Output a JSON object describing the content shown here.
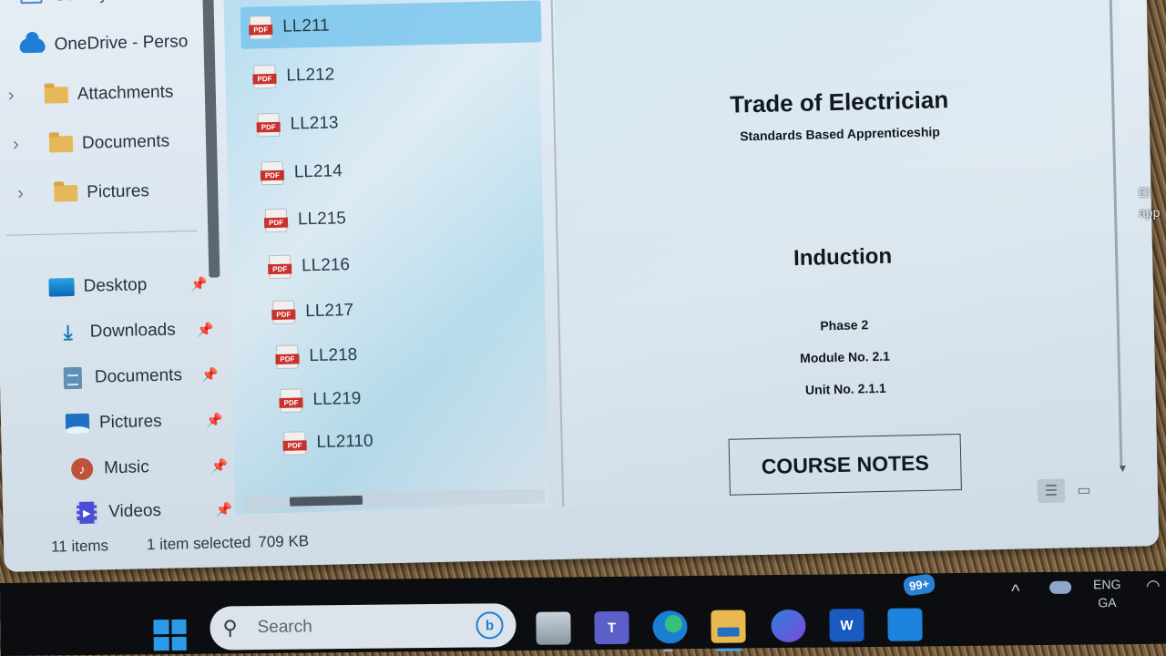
{
  "sidebar": {
    "top_partial": "Gallery",
    "onedrive": {
      "label": "OneDrive - Perso",
      "icon": "cloud-icon"
    },
    "onedrive_children": [
      {
        "label": "Attachments",
        "icon": "folder-icon"
      },
      {
        "label": "Documents",
        "icon": "folder-icon"
      },
      {
        "label": "Pictures",
        "icon": "folder-icon"
      }
    ],
    "quick_access": [
      {
        "label": "Desktop",
        "icon": "desktop-icon",
        "pinned": true
      },
      {
        "label": "Downloads",
        "icon": "download-icon",
        "pinned": true
      },
      {
        "label": "Documents",
        "icon": "documents-icon",
        "pinned": true
      },
      {
        "label": "Pictures",
        "icon": "pictures-icon",
        "pinned": true
      },
      {
        "label": "Music",
        "icon": "music-icon",
        "pinned": true
      },
      {
        "label": "Videos",
        "icon": "videos-icon",
        "pinned": true
      }
    ],
    "pin_glyph": "📌"
  },
  "files": {
    "icon_label": "PDF",
    "items": [
      {
        "name": "LL211",
        "selected": true
      },
      {
        "name": "LL212"
      },
      {
        "name": "LL213"
      },
      {
        "name": "LL214"
      },
      {
        "name": "LL215"
      },
      {
        "name": "LL216"
      },
      {
        "name": "LL217"
      },
      {
        "name": "LL218"
      },
      {
        "name": "LL219"
      },
      {
        "name": "LL2110"
      }
    ]
  },
  "preview": {
    "title": "Trade of Electrician",
    "subtitle": "Standards Based Apprenticeship",
    "heading": "Induction",
    "phase": "Phase 2",
    "module": "Module No. 2.1",
    "unit": "Unit No. 2.1.1",
    "box_label": "COURSE NOTES"
  },
  "status": {
    "item_count": "11 items",
    "selection": "1 item selected",
    "size": "709 KB"
  },
  "desktop_peek": [
    "El",
    "app"
  ],
  "taskbar": {
    "search_placeholder": "Search",
    "bing_glyph": "b",
    "apps": [
      {
        "name": "task-view",
        "glyph": ""
      },
      {
        "name": "teams",
        "glyph": "T"
      },
      {
        "name": "edge",
        "glyph": "e"
      },
      {
        "name": "file-explorer",
        "glyph": ""
      },
      {
        "name": "microsoft-365",
        "glyph": ""
      },
      {
        "name": "word",
        "glyph": "W"
      },
      {
        "name": "mail",
        "glyph": ""
      }
    ],
    "mail_badge": "99+",
    "tray": {
      "chevron": "^",
      "lang_line1": "ENG",
      "lang_line2": "GA"
    }
  },
  "colors": {
    "accent": "#2a9be8",
    "selection": "#70c2ec",
    "pdf_red": "#c9322c",
    "folder": "#e7b85a"
  }
}
